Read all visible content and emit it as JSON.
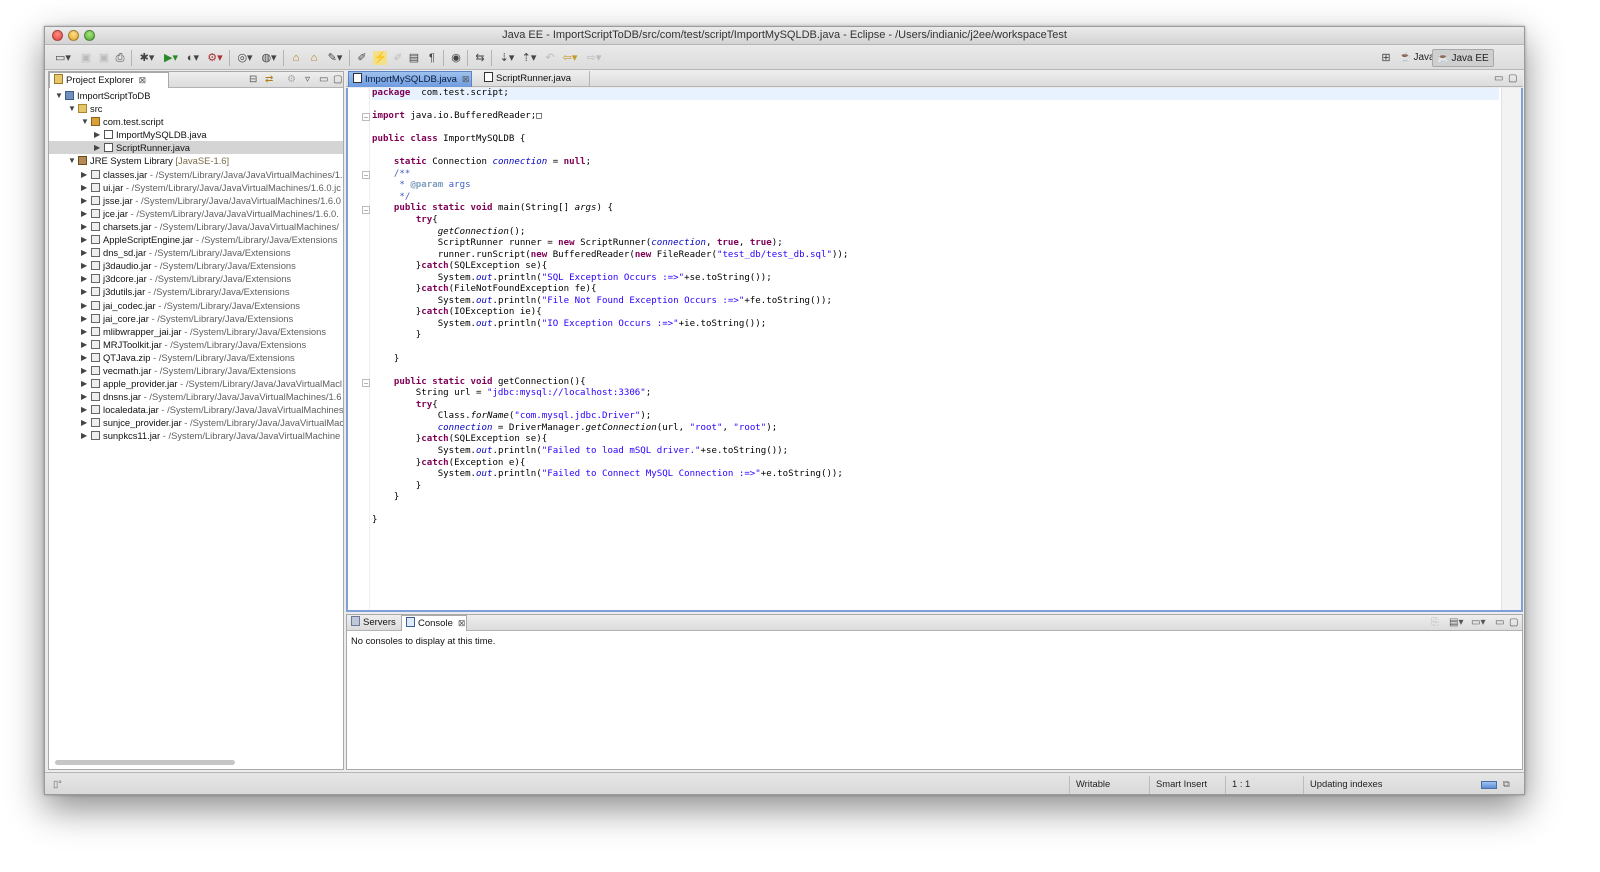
{
  "window": {
    "title": "Java EE - ImportScriptToDB/src/com/test/script/ImportMySQLDB.java - Eclipse - /Users/indianic/j2ee/workspaceTest"
  },
  "perspectives": [
    {
      "label": "Java",
      "active": false
    },
    {
      "label": "Java EE",
      "active": true
    }
  ],
  "project_explorer": {
    "tab_label": "Project Explorer",
    "tree": [
      {
        "depth": 0,
        "twisty": "open",
        "icon": "proj",
        "label": "ImportScriptToDB",
        "path": ""
      },
      {
        "depth": 1,
        "twisty": "open",
        "icon": "src",
        "label": "src",
        "path": ""
      },
      {
        "depth": 2,
        "twisty": "open",
        "icon": "pkg",
        "label": "com.test.script",
        "path": ""
      },
      {
        "depth": 3,
        "twisty": "closed",
        "icon": "jfile",
        "label": "ImportMySQLDB.java",
        "path": ""
      },
      {
        "depth": 3,
        "twisty": "closed",
        "icon": "jfile",
        "label": "ScriptRunner.java",
        "path": "",
        "selected": true
      },
      {
        "depth": 1,
        "twisty": "open",
        "icon": "lib",
        "label": "JRE System Library",
        "path": "[JavaSE-1.6]",
        "path_style": "dim"
      },
      {
        "depth": 2,
        "twisty": "closed",
        "icon": "jar",
        "label": "classes.jar",
        "path": "- /System/Library/Java/JavaVirtualMachines/1."
      },
      {
        "depth": 2,
        "twisty": "closed",
        "icon": "jar",
        "label": "ui.jar",
        "path": "- /System/Library/Java/JavaVirtualMachines/1.6.0.jc"
      },
      {
        "depth": 2,
        "twisty": "closed",
        "icon": "jar",
        "label": "jsse.jar",
        "path": "- /System/Library/Java/JavaVirtualMachines/1.6.0"
      },
      {
        "depth": 2,
        "twisty": "closed",
        "icon": "jar",
        "label": "jce.jar",
        "path": "- /System/Library/Java/JavaVirtualMachines/1.6.0."
      },
      {
        "depth": 2,
        "twisty": "closed",
        "icon": "jar",
        "label": "charsets.jar",
        "path": "- /System/Library/Java/JavaVirtualMachines/"
      },
      {
        "depth": 2,
        "twisty": "closed",
        "icon": "jar",
        "label": "AppleScriptEngine.jar",
        "path": "- /System/Library/Java/Extensions"
      },
      {
        "depth": 2,
        "twisty": "closed",
        "icon": "jar",
        "label": "dns_sd.jar",
        "path": "- /System/Library/Java/Extensions"
      },
      {
        "depth": 2,
        "twisty": "closed",
        "icon": "jar",
        "label": "j3daudio.jar",
        "path": "- /System/Library/Java/Extensions"
      },
      {
        "depth": 2,
        "twisty": "closed",
        "icon": "jar",
        "label": "j3dcore.jar",
        "path": "- /System/Library/Java/Extensions"
      },
      {
        "depth": 2,
        "twisty": "closed",
        "icon": "jar",
        "label": "j3dutils.jar",
        "path": "- /System/Library/Java/Extensions"
      },
      {
        "depth": 2,
        "twisty": "closed",
        "icon": "jar",
        "label": "jai_codec.jar",
        "path": "- /System/Library/Java/Extensions"
      },
      {
        "depth": 2,
        "twisty": "closed",
        "icon": "jar",
        "label": "jai_core.jar",
        "path": "- /System/Library/Java/Extensions"
      },
      {
        "depth": 2,
        "twisty": "closed",
        "icon": "jar",
        "label": "mlibwrapper_jai.jar",
        "path": "- /System/Library/Java/Extensions"
      },
      {
        "depth": 2,
        "twisty": "closed",
        "icon": "jar",
        "label": "MRJToolkit.jar",
        "path": "- /System/Library/Java/Extensions"
      },
      {
        "depth": 2,
        "twisty": "closed",
        "icon": "jar",
        "label": "QTJava.zip",
        "path": "- /System/Library/Java/Extensions"
      },
      {
        "depth": 2,
        "twisty": "closed",
        "icon": "jar",
        "label": "vecmath.jar",
        "path": "- /System/Library/Java/Extensions"
      },
      {
        "depth": 2,
        "twisty": "closed",
        "icon": "jar",
        "label": "apple_provider.jar",
        "path": "- /System/Library/Java/JavaVirtualMacl"
      },
      {
        "depth": 2,
        "twisty": "closed",
        "icon": "jar",
        "label": "dnsns.jar",
        "path": "- /System/Library/Java/JavaVirtualMachines/1.6"
      },
      {
        "depth": 2,
        "twisty": "closed",
        "icon": "jar",
        "label": "localedata.jar",
        "path": "- /System/Library/Java/JavaVirtualMachines"
      },
      {
        "depth": 2,
        "twisty": "closed",
        "icon": "jar",
        "label": "sunjce_provider.jar",
        "path": "- /System/Library/Java/JavaVirtualMac"
      },
      {
        "depth": 2,
        "twisty": "closed",
        "icon": "jar",
        "label": "sunpkcs11.jar",
        "path": "- /System/Library/Java/JavaVirtualMachine"
      }
    ]
  },
  "editor": {
    "tabs": [
      {
        "label": "ImportMySQLDB.java",
        "active": true
      },
      {
        "label": "ScriptRunner.java",
        "active": false
      }
    ],
    "lines": [
      {
        "fold": false,
        "cur": true,
        "segs": [
          [
            "kw",
            "package"
          ],
          [
            "",
            "  com.test.script;"
          ]
        ]
      },
      {
        "fold": false,
        "segs": []
      },
      {
        "fold": true,
        "segs": [
          [
            "kw",
            "import"
          ],
          [
            "",
            " java.io.BufferedReader;□"
          ]
        ]
      },
      {
        "fold": false,
        "segs": []
      },
      {
        "fold": false,
        "segs": [
          [
            "kw",
            "public class"
          ],
          [
            "",
            " ImportMySQLDB {"
          ]
        ]
      },
      {
        "fold": false,
        "segs": []
      },
      {
        "fold": false,
        "segs": [
          [
            "",
            "    "
          ],
          [
            "kw",
            "static"
          ],
          [
            "",
            " Connection "
          ],
          [
            "fld",
            "connection"
          ],
          [
            "",
            " = "
          ],
          [
            "kw",
            "null"
          ],
          [
            "",
            ";"
          ]
        ]
      },
      {
        "fold": true,
        "segs": [
          [
            "",
            "    "
          ],
          [
            "cm",
            "/**"
          ]
        ]
      },
      {
        "fold": false,
        "segs": [
          [
            "",
            "     "
          ],
          [
            "cm",
            "* "
          ],
          [
            "tag",
            "@param"
          ],
          [
            "cm",
            " args"
          ]
        ]
      },
      {
        "fold": false,
        "segs": [
          [
            "",
            "     "
          ],
          [
            "cm",
            "*/"
          ]
        ]
      },
      {
        "fold": true,
        "segs": [
          [
            "",
            "    "
          ],
          [
            "kw",
            "public static void"
          ],
          [
            "",
            " main(String[] "
          ],
          [
            "sm",
            "args"
          ],
          [
            "",
            ") {"
          ]
        ]
      },
      {
        "fold": false,
        "segs": [
          [
            "",
            "        "
          ],
          [
            "kw",
            "try"
          ],
          [
            "",
            "{"
          ]
        ]
      },
      {
        "fold": false,
        "segs": [
          [
            "",
            "            "
          ],
          [
            "sm",
            "getConnection"
          ],
          [
            "",
            "();"
          ]
        ]
      },
      {
        "fold": false,
        "segs": [
          [
            "",
            "            ScriptRunner runner = "
          ],
          [
            "kw",
            "new"
          ],
          [
            "",
            " ScriptRunner("
          ],
          [
            "fld",
            "connection"
          ],
          [
            "",
            ", "
          ],
          [
            "kw",
            "true"
          ],
          [
            "",
            ", "
          ],
          [
            "kw",
            "true"
          ],
          [
            "",
            ");"
          ]
        ]
      },
      {
        "fold": false,
        "segs": [
          [
            "",
            "            runner.runScript("
          ],
          [
            "kw",
            "new"
          ],
          [
            "",
            " BufferedReader("
          ],
          [
            "kw",
            "new"
          ],
          [
            "",
            " FileReader("
          ],
          [
            "st",
            "\"test_db/test_db.sql\""
          ],
          [
            "",
            "));"
          ]
        ]
      },
      {
        "fold": false,
        "segs": [
          [
            "",
            "        }"
          ],
          [
            "kw",
            "catch"
          ],
          [
            "",
            "(SQLException se){"
          ]
        ]
      },
      {
        "fold": false,
        "segs": [
          [
            "",
            "            System."
          ],
          [
            "fld",
            "out"
          ],
          [
            "",
            ".println("
          ],
          [
            "st",
            "\"SQL Exception Occurs :=>\""
          ],
          [
            "",
            "+se.toString());"
          ]
        ]
      },
      {
        "fold": false,
        "segs": [
          [
            "",
            "        }"
          ],
          [
            "kw",
            "catch"
          ],
          [
            "",
            "(FileNotFoundException fe){"
          ]
        ]
      },
      {
        "fold": false,
        "segs": [
          [
            "",
            "            System."
          ],
          [
            "fld",
            "out"
          ],
          [
            "",
            ".println("
          ],
          [
            "st",
            "\"File Not Found Exception Occurs :=>\""
          ],
          [
            "",
            "+fe.toString());"
          ]
        ]
      },
      {
        "fold": false,
        "segs": [
          [
            "",
            "        }"
          ],
          [
            "kw",
            "catch"
          ],
          [
            "",
            "(IOException ie){"
          ]
        ]
      },
      {
        "fold": false,
        "segs": [
          [
            "",
            "            System."
          ],
          [
            "fld",
            "out"
          ],
          [
            "",
            ".println("
          ],
          [
            "st",
            "\"IO Exception Occurs :=>\""
          ],
          [
            "",
            "+ie.toString());"
          ]
        ]
      },
      {
        "fold": false,
        "segs": [
          [
            "",
            "        }"
          ]
        ]
      },
      {
        "fold": false,
        "segs": []
      },
      {
        "fold": false,
        "segs": [
          [
            "",
            "    }"
          ]
        ]
      },
      {
        "fold": false,
        "segs": []
      },
      {
        "fold": true,
        "segs": [
          [
            "",
            "    "
          ],
          [
            "kw",
            "public static void"
          ],
          [
            "",
            " getConnection(){"
          ]
        ]
      },
      {
        "fold": false,
        "segs": [
          [
            "",
            "        String url = "
          ],
          [
            "st",
            "\"jdbc:mysql://localhost:3306\""
          ],
          [
            "",
            ";"
          ]
        ]
      },
      {
        "fold": false,
        "segs": [
          [
            "",
            "        "
          ],
          [
            "kw",
            "try"
          ],
          [
            "",
            "{"
          ]
        ]
      },
      {
        "fold": false,
        "segs": [
          [
            "",
            "            Class."
          ],
          [
            "sm",
            "forName"
          ],
          [
            "",
            "("
          ],
          [
            "st",
            "\"com.mysql.jdbc.Driver\""
          ],
          [
            "",
            ");"
          ]
        ]
      },
      {
        "fold": false,
        "segs": [
          [
            "",
            "            "
          ],
          [
            "fld",
            "connection"
          ],
          [
            "",
            " = DriverManager."
          ],
          [
            "sm",
            "getConnection"
          ],
          [
            "",
            "(url, "
          ],
          [
            "st",
            "\"root\""
          ],
          [
            "",
            ", "
          ],
          [
            "st",
            "\"root\""
          ],
          [
            "",
            ");"
          ]
        ]
      },
      {
        "fold": false,
        "segs": [
          [
            "",
            "        }"
          ],
          [
            "kw",
            "catch"
          ],
          [
            "",
            "(SQLException se){"
          ]
        ]
      },
      {
        "fold": false,
        "segs": [
          [
            "",
            "            System."
          ],
          [
            "fld",
            "out"
          ],
          [
            "",
            ".println("
          ],
          [
            "st",
            "\"Failed to load mSQL driver.\""
          ],
          [
            "",
            "+se.toString());"
          ]
        ]
      },
      {
        "fold": false,
        "segs": [
          [
            "",
            "        }"
          ],
          [
            "kw",
            "catch"
          ],
          [
            "",
            "(Exception e){"
          ]
        ]
      },
      {
        "fold": false,
        "segs": [
          [
            "",
            "            System."
          ],
          [
            "fld",
            "out"
          ],
          [
            "",
            ".println("
          ],
          [
            "st",
            "\"Failed to Connect MySQL Connection :=>\""
          ],
          [
            "",
            "+e.toString());"
          ]
        ]
      },
      {
        "fold": false,
        "segs": [
          [
            "",
            "        }"
          ]
        ]
      },
      {
        "fold": false,
        "segs": [
          [
            "",
            "    }"
          ]
        ]
      },
      {
        "fold": false,
        "segs": []
      },
      {
        "fold": false,
        "segs": [
          [
            "",
            "}"
          ]
        ]
      }
    ]
  },
  "console_panel": {
    "tabs": [
      {
        "label": "Servers",
        "active": false
      },
      {
        "label": "Console",
        "active": true
      }
    ],
    "message": "No consoles to display at this time."
  },
  "status_bar": {
    "writable": "Writable",
    "insert_mode": "Smart Insert",
    "position": "1 : 1",
    "task": "Updating indexes"
  }
}
